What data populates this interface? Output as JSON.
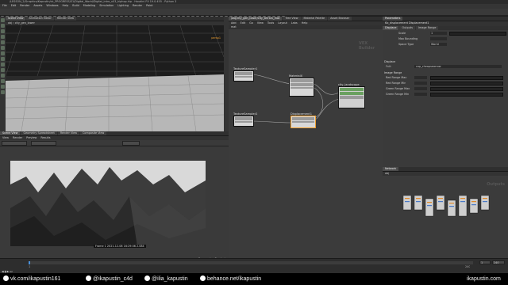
{
  "window": {
    "title": "/LESSON_2/Graphics/Kapustin/ck_PROGRESS/S1/Digital_World/Digital_intro_v03_hiphop.hip - Houdini FX 19.0.455 - Python 3"
  },
  "menu": [
    "File",
    "Edit",
    "Render",
    "Assets",
    "Windows",
    "Help",
    "Build",
    "Modeling",
    "Simulation",
    "Lighting",
    "Render",
    "Paint"
  ],
  "viewport": {
    "tabs": [
      "Scene View",
      "Animation Editor",
      "Render View"
    ],
    "path": "obj",
    "path2": "city_gen_lower",
    "camera": "persp1"
  },
  "render_view": {
    "tabs": [
      "Scene View",
      "Geometry Spreadsheet",
      "Render View",
      "Composite View"
    ],
    "menus": [
      "View",
      "Render",
      "Preview",
      "Results"
    ],
    "status": "Frame 1  2021-12-08 16:29:06  2.084",
    "progress_label": "Progressive Rendering"
  },
  "network": {
    "tabs": [
      "/obj/city_gen_lower/city_terrain_mat",
      "Tree View",
      "Material Palette",
      "Asset Browser"
    ],
    "menus": [
      "Add",
      "Edit",
      "Go",
      "View",
      "Tools",
      "Layout",
      "Labs",
      "Help"
    ],
    "path": "mat",
    "context": "VEX Builder",
    "nodes": [
      {
        "name": "TextureSampler1"
      },
      {
        "name": "TextureSampler2"
      },
      {
        "name": "MaterialX"
      },
      {
        "name": "Displacement1"
      },
      {
        "name": "city_landscape"
      }
    ]
  },
  "params": {
    "header": "Kb_displacement  Displacement1",
    "tabs": [
      "Displace",
      "Outputs",
      "Image Range"
    ],
    "labels": [
      "Scale",
      "Max Bounding",
      "Space Type"
    ],
    "values": [
      "1",
      "",
      "World"
    ],
    "section": "Displace",
    "image_label": "Image Range",
    "rows": [
      "Red Range Max",
      "Red Range Min",
      "Green Range Max",
      "Green Range Min"
    ],
    "file_label": "Path",
    "file_value": "cop_cheapsearrow"
  },
  "outputs": {
    "title": "Outputs",
    "path": "obj"
  },
  "timeline": {
    "frame": "1",
    "end": "240",
    "start": "1",
    "total": "240"
  },
  "footer": {
    "vk": "vk.com/ikapustin161",
    "ig1": "@ikapustin_c4d",
    "ig2": "@ilia_kapustin",
    "behance": "behance.net/ikapustin",
    "brand": "ikapustin.com"
  },
  "colors": {
    "accent_orange": "#f0a030",
    "node_bg": "#d8d8d8",
    "footer_bg": "#000000"
  }
}
